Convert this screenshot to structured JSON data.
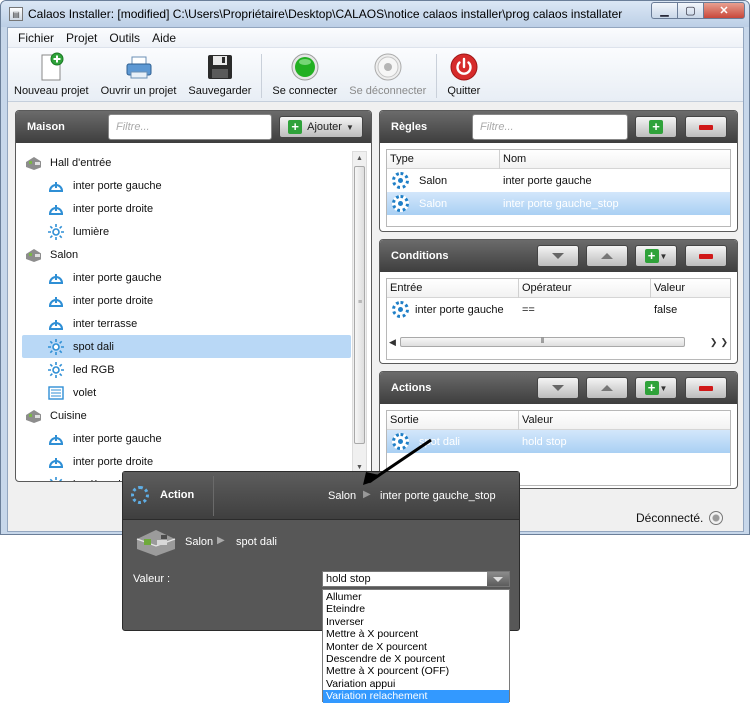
{
  "window": {
    "title": "Calaos Installer: [modified] C:\\Users\\Propriétaire\\Desktop\\CALAOS\\notice calaos installer\\prog calaos installater"
  },
  "menu": [
    "Fichier",
    "Projet",
    "Outils",
    "Aide"
  ],
  "toolbar": {
    "new": "Nouveau projet",
    "open": "Ouvrir un projet",
    "save": "Sauvegarder",
    "connect": "Se connecter",
    "disconnect": "Se déconnecter",
    "quit": "Quitter"
  },
  "maison": {
    "title": "Maison",
    "filter_placeholder": "Filtre...",
    "add_label": "Ajouter",
    "tree": [
      {
        "label": "Hall d'entrée",
        "type": "room",
        "icon": "room-icon"
      },
      {
        "label": "inter porte gauche",
        "type": "child",
        "icon": "switch-icon"
      },
      {
        "label": "inter porte droite",
        "type": "child",
        "icon": "switch-icon"
      },
      {
        "label": "lumière",
        "type": "child",
        "icon": "light-icon"
      },
      {
        "label": "Salon",
        "type": "room",
        "icon": "room-icon"
      },
      {
        "label": "inter porte gauche",
        "type": "child",
        "icon": "switch-icon"
      },
      {
        "label": "inter porte droite",
        "type": "child",
        "icon": "switch-icon"
      },
      {
        "label": "inter terrasse",
        "type": "child",
        "icon": "switch-icon"
      },
      {
        "label": "spot dali",
        "type": "child",
        "icon": "light-icon",
        "selected": true
      },
      {
        "label": "led RGB",
        "type": "child",
        "icon": "light-icon"
      },
      {
        "label": "volet",
        "type": "child",
        "icon": "shutter-icon"
      },
      {
        "label": "Cuisine",
        "type": "room",
        "icon": "room-icon"
      },
      {
        "label": "inter porte gauche",
        "type": "child",
        "icon": "switch-icon"
      },
      {
        "label": "inter porte droite",
        "type": "child",
        "icon": "switch-icon"
      },
      {
        "label": "lumière pl",
        "type": "child",
        "icon": "light-icon"
      }
    ]
  },
  "regles": {
    "title": "Règles",
    "filter_placeholder": "Filtre...",
    "columns": [
      "Type",
      "Nom"
    ],
    "rows": [
      {
        "type": "Salon",
        "name": "inter porte gauche"
      },
      {
        "type": "Salon",
        "name": "inter porte gauche_stop",
        "selected": true
      }
    ]
  },
  "conditions": {
    "title": "Conditions",
    "columns": [
      "Entrée",
      "Opérateur",
      "Valeur"
    ],
    "rows": [
      {
        "entree": "inter porte gauche",
        "op": "==",
        "valeur": "false"
      }
    ]
  },
  "actions": {
    "title": "Actions",
    "columns": [
      "Sortie",
      "Valeur"
    ],
    "rows": [
      {
        "sortie": "spot dali",
        "valeur": "hold stop",
        "selected": true
      }
    ]
  },
  "status": {
    "text": "Déconnecté."
  },
  "popup": {
    "title": "Action",
    "room": "Salon",
    "rule": "inter porte gauche_stop",
    "device_room": "Salon",
    "device": "spot dali",
    "value_label": "Valeur :",
    "current_value": "hold stop",
    "options": [
      "Allumer",
      "Eteindre",
      "Inverser",
      "Mettre à X pourcent",
      "Monter de X pourcent",
      "Descendre de X pourcent",
      "Mettre à X pourcent (OFF)",
      "Variation appui",
      "Variation relachement"
    ],
    "highlighted_option": "Variation relachement"
  },
  "colors": {
    "accent": "#3399ff",
    "selection": "#b9d8f6",
    "panel_header": "#4a4a4a",
    "add": "#2fa23a",
    "remove": "#d01818"
  }
}
